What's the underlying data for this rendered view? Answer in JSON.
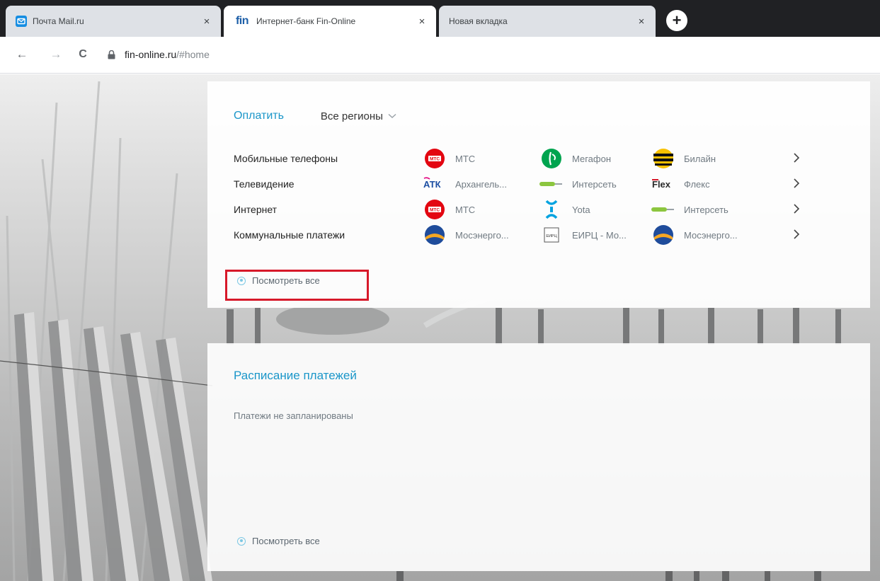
{
  "browser": {
    "tabs": [
      {
        "title": "Почта Mail.ru",
        "active": false
      },
      {
        "title": "Интернет-банк Fin-Online",
        "active": true
      },
      {
        "title": "Новая вкладка",
        "active": false
      }
    ],
    "close_glyph": "×",
    "new_tab_glyph": "+",
    "url_host": "fin-online.ru",
    "url_path": "/#home",
    "nav": {
      "back": "←",
      "forward": "→",
      "reload": "C"
    }
  },
  "favicons": {
    "mail": "mail-icon",
    "fin_logo_text": "fin"
  },
  "payments": {
    "title": "Оплатить",
    "region": "Все регионы",
    "categories": [
      {
        "label": "Мобильные телефоны",
        "providers": [
          "МТС",
          "Мегафон",
          "Билайн"
        ]
      },
      {
        "label": "Телевидение",
        "providers": [
          "Архангель...",
          "Интерсеть",
          "Флекс"
        ]
      },
      {
        "label": "Интернет",
        "providers": [
          "МТС",
          "Yota",
          "Интерсеть"
        ]
      },
      {
        "label": "Коммунальные платежи",
        "providers": [
          "Мосэнерго...",
          "ЕИРЦ - Мо...",
          "Мосэнерго..."
        ]
      }
    ],
    "logo_text": {
      "mts": "МТС",
      "atk": "АТК",
      "flex": "Flex",
      "eirc": "ЕИРЦ"
    },
    "see_all": "Посмотреть все"
  },
  "schedule": {
    "title": "Расписание платежей",
    "empty_text": "Платежи не запланированы",
    "see_all": "Посмотреть все"
  },
  "colors": {
    "accent": "#1a96c9",
    "highlight": "#d7192a",
    "mts_red": "#e30611",
    "megafon_green": "#00a44f",
    "beeline_yellow": "#f9c100",
    "intersvet_green": "#8cc63f",
    "yota_blue": "#00a3e0"
  }
}
